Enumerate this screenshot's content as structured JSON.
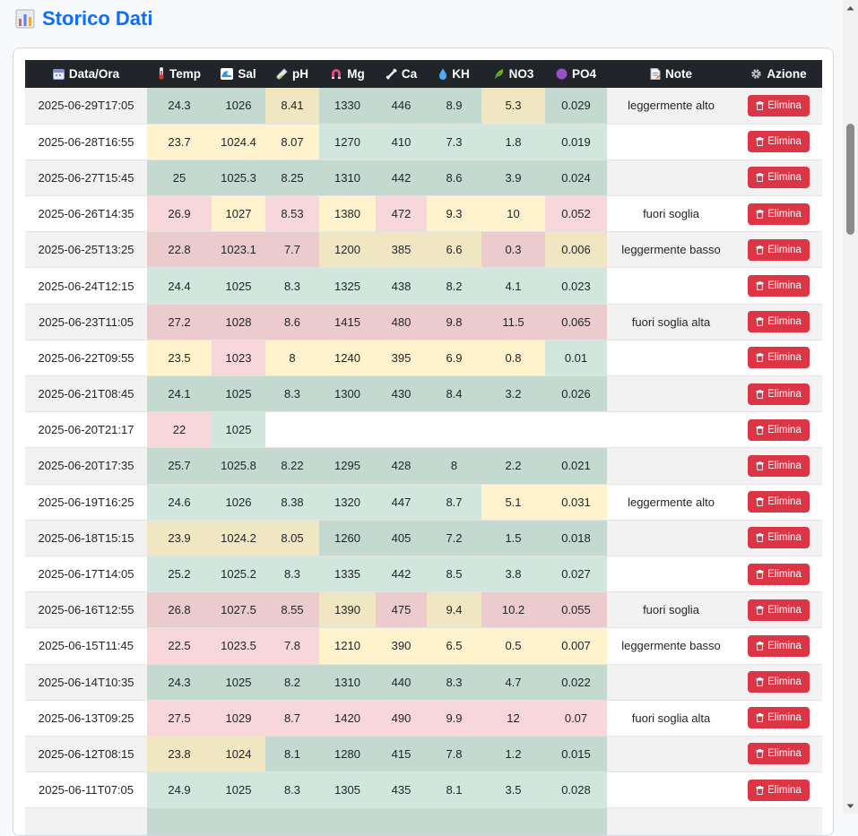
{
  "page": {
    "title": "Storico Dati",
    "title_icon": "bar-chart-icon"
  },
  "table": {
    "headers": [
      {
        "label": "Data/Ora",
        "icon": "calendar-icon"
      },
      {
        "label": "Temp",
        "icon": "thermometer-icon"
      },
      {
        "label": "Sal",
        "icon": "wave-icon"
      },
      {
        "label": "pH",
        "icon": "test-tube-icon"
      },
      {
        "label": "Mg",
        "icon": "magnet-icon"
      },
      {
        "label": "Ca",
        "icon": "bone-icon"
      },
      {
        "label": "KH",
        "icon": "droplet-icon"
      },
      {
        "label": "NO3",
        "icon": "leaf-icon"
      },
      {
        "label": "PO4",
        "icon": "purple-circle-icon"
      },
      {
        "label": "Note",
        "icon": "note-icon"
      },
      {
        "label": "Azione",
        "icon": "gear-icon"
      }
    ],
    "delete_label": "Elimina",
    "status_colors": {
      "ok": "#d1e7dd",
      "warn": "#fff3cd",
      "alert": "#f8d7da"
    },
    "rows": [
      {
        "date": "2025-06-29T17:05",
        "temp": "24.3",
        "sal": "1026",
        "ph": "8.41",
        "mg": "1330",
        "ca": "446",
        "kh": "8.9",
        "no3": "5.3",
        "po4": "0.029",
        "note": "leggermente alto",
        "s": [
          "g",
          "g",
          "y",
          "g",
          "g",
          "g",
          "y",
          "g"
        ]
      },
      {
        "date": "2025-06-28T16:55",
        "temp": "23.7",
        "sal": "1024.4",
        "ph": "8.07",
        "mg": "1270",
        "ca": "410",
        "kh": "7.3",
        "no3": "1.8",
        "po4": "0.019",
        "note": "",
        "s": [
          "y",
          "y",
          "y",
          "g",
          "g",
          "g",
          "g",
          "g"
        ]
      },
      {
        "date": "2025-06-27T15:45",
        "temp": "25",
        "sal": "1025.3",
        "ph": "8.25",
        "mg": "1310",
        "ca": "442",
        "kh": "8.6",
        "no3": "3.9",
        "po4": "0.024",
        "note": "",
        "s": [
          "g",
          "g",
          "g",
          "g",
          "g",
          "g",
          "g",
          "g"
        ]
      },
      {
        "date": "2025-06-26T14:35",
        "temp": "26.9",
        "sal": "1027",
        "ph": "8.53",
        "mg": "1380",
        "ca": "472",
        "kh": "9.3",
        "no3": "10",
        "po4": "0.052",
        "note": "fuori soglia",
        "s": [
          "r",
          "y",
          "r",
          "y",
          "r",
          "y",
          "y",
          "r"
        ]
      },
      {
        "date": "2025-06-25T13:25",
        "temp": "22.8",
        "sal": "1023.1",
        "ph": "7.7",
        "mg": "1200",
        "ca": "385",
        "kh": "6.6",
        "no3": "0.3",
        "po4": "0.006",
        "note": "leggermente basso",
        "s": [
          "r",
          "r",
          "r",
          "y",
          "y",
          "y",
          "r",
          "y"
        ]
      },
      {
        "date": "2025-06-24T12:15",
        "temp": "24.4",
        "sal": "1025",
        "ph": "8.3",
        "mg": "1325",
        "ca": "438",
        "kh": "8.2",
        "no3": "4.1",
        "po4": "0.023",
        "note": "",
        "s": [
          "g",
          "g",
          "g",
          "g",
          "g",
          "g",
          "g",
          "g"
        ]
      },
      {
        "date": "2025-06-23T11:05",
        "temp": "27.2",
        "sal": "1028",
        "ph": "8.6",
        "mg": "1415",
        "ca": "480",
        "kh": "9.8",
        "no3": "11.5",
        "po4": "0.065",
        "note": "fuori soglia alta",
        "s": [
          "r",
          "r",
          "r",
          "r",
          "r",
          "r",
          "r",
          "r"
        ]
      },
      {
        "date": "2025-06-22T09:55",
        "temp": "23.5",
        "sal": "1023",
        "ph": "8",
        "mg": "1240",
        "ca": "395",
        "kh": "6.9",
        "no3": "0.8",
        "po4": "0.01",
        "note": "",
        "s": [
          "y",
          "r",
          "y",
          "y",
          "y",
          "y",
          "y",
          "g"
        ]
      },
      {
        "date": "2025-06-21T08:45",
        "temp": "24.1",
        "sal": "1025",
        "ph": "8.3",
        "mg": "1300",
        "ca": "430",
        "kh": "8.4",
        "no3": "3.2",
        "po4": "0.026",
        "note": "",
        "s": [
          "g",
          "g",
          "g",
          "g",
          "g",
          "g",
          "g",
          "g"
        ]
      },
      {
        "date": "2025-06-20T21:17",
        "temp": "22",
        "sal": "1025",
        "ph": "",
        "mg": "",
        "ca": "",
        "kh": "",
        "no3": "",
        "po4": "",
        "note": "",
        "s": [
          "r",
          "g",
          "",
          "",
          "",
          "",
          "",
          ""
        ]
      },
      {
        "date": "2025-06-20T17:35",
        "temp": "25.7",
        "sal": "1025.8",
        "ph": "8.22",
        "mg": "1295",
        "ca": "428",
        "kh": "8",
        "no3": "2.2",
        "po4": "0.021",
        "note": "",
        "s": [
          "g",
          "g",
          "g",
          "g",
          "g",
          "g",
          "g",
          "g"
        ]
      },
      {
        "date": "2025-06-19T16:25",
        "temp": "24.6",
        "sal": "1026",
        "ph": "8.38",
        "mg": "1320",
        "ca": "447",
        "kh": "8.7",
        "no3": "5.1",
        "po4": "0.031",
        "note": "leggermente alto",
        "s": [
          "g",
          "g",
          "g",
          "g",
          "g",
          "g",
          "y",
          "y"
        ]
      },
      {
        "date": "2025-06-18T15:15",
        "temp": "23.9",
        "sal": "1024.2",
        "ph": "8.05",
        "mg": "1260",
        "ca": "405",
        "kh": "7.2",
        "no3": "1.5",
        "po4": "0.018",
        "note": "",
        "s": [
          "y",
          "y",
          "y",
          "g",
          "g",
          "g",
          "g",
          "g"
        ]
      },
      {
        "date": "2025-06-17T14:05",
        "temp": "25.2",
        "sal": "1025.2",
        "ph": "8.3",
        "mg": "1335",
        "ca": "442",
        "kh": "8.5",
        "no3": "3.8",
        "po4": "0.027",
        "note": "",
        "s": [
          "g",
          "g",
          "g",
          "g",
          "g",
          "g",
          "g",
          "g"
        ]
      },
      {
        "date": "2025-06-16T12:55",
        "temp": "26.8",
        "sal": "1027.5",
        "ph": "8.55",
        "mg": "1390",
        "ca": "475",
        "kh": "9.4",
        "no3": "10.2",
        "po4": "0.055",
        "note": "fuori soglia",
        "s": [
          "r",
          "r",
          "r",
          "y",
          "r",
          "y",
          "r",
          "r"
        ]
      },
      {
        "date": "2025-06-15T11:45",
        "temp": "22.5",
        "sal": "1023.5",
        "ph": "7.8",
        "mg": "1210",
        "ca": "390",
        "kh": "6.5",
        "no3": "0.5",
        "po4": "0.007",
        "note": "leggermente basso",
        "s": [
          "r",
          "r",
          "r",
          "y",
          "y",
          "y",
          "y",
          "y"
        ]
      },
      {
        "date": "2025-06-14T10:35",
        "temp": "24.3",
        "sal": "1025",
        "ph": "8.2",
        "mg": "1310",
        "ca": "440",
        "kh": "8.3",
        "no3": "4.7",
        "po4": "0.022",
        "note": "",
        "s": [
          "g",
          "g",
          "g",
          "g",
          "g",
          "g",
          "g",
          "g"
        ]
      },
      {
        "date": "2025-06-13T09:25",
        "temp": "27.5",
        "sal": "1029",
        "ph": "8.7",
        "mg": "1420",
        "ca": "490",
        "kh": "9.9",
        "no3": "12",
        "po4": "0.07",
        "note": "fuori soglia alta",
        "s": [
          "r",
          "r",
          "r",
          "r",
          "r",
          "r",
          "r",
          "r"
        ]
      },
      {
        "date": "2025-06-12T08:15",
        "temp": "23.8",
        "sal": "1024",
        "ph": "8.1",
        "mg": "1280",
        "ca": "415",
        "kh": "7.8",
        "no3": "1.2",
        "po4": "0.015",
        "note": "",
        "s": [
          "y",
          "y",
          "g",
          "g",
          "g",
          "g",
          "g",
          "g"
        ]
      },
      {
        "date": "2025-06-11T07:05",
        "temp": "24.9",
        "sal": "1025",
        "ph": "8.3",
        "mg": "1305",
        "ca": "435",
        "kh": "8.1",
        "no3": "3.5",
        "po4": "0.028",
        "note": "",
        "s": [
          "g",
          "g",
          "g",
          "g",
          "g",
          "g",
          "g",
          "g"
        ]
      },
      {
        "date": "",
        "temp": "",
        "sal": "",
        "ph": "",
        "mg": "",
        "ca": "",
        "kh": "",
        "no3": "",
        "po4": "",
        "note": "",
        "s": [
          "g",
          "g",
          "g",
          "g",
          "g",
          "g",
          "g",
          "g"
        ]
      }
    ]
  }
}
